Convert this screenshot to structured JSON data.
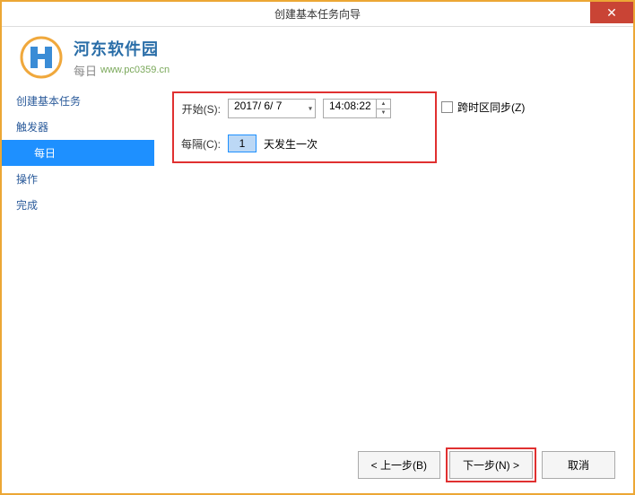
{
  "window": {
    "title": "创建基本任务向导"
  },
  "brand": {
    "main": "河东软件园",
    "subtitle": "每日",
    "url": "www.pc0359.cn"
  },
  "sidebar": {
    "items": [
      {
        "label": "创建基本任务"
      },
      {
        "label": "触发器"
      },
      {
        "label": "每日"
      },
      {
        "label": "操作"
      },
      {
        "label": "完成"
      }
    ]
  },
  "form": {
    "start_label": "开始(S):",
    "date_value": "2017/ 6/ 7",
    "time_value": "14:08:22",
    "sync_label": "跨时区同步(Z)",
    "interval_label": "每隔(C):",
    "interval_value": "1",
    "interval_suffix": "天发生一次"
  },
  "footer": {
    "back": "< 上一步(B)",
    "next": "下一步(N) >",
    "cancel": "取消"
  }
}
